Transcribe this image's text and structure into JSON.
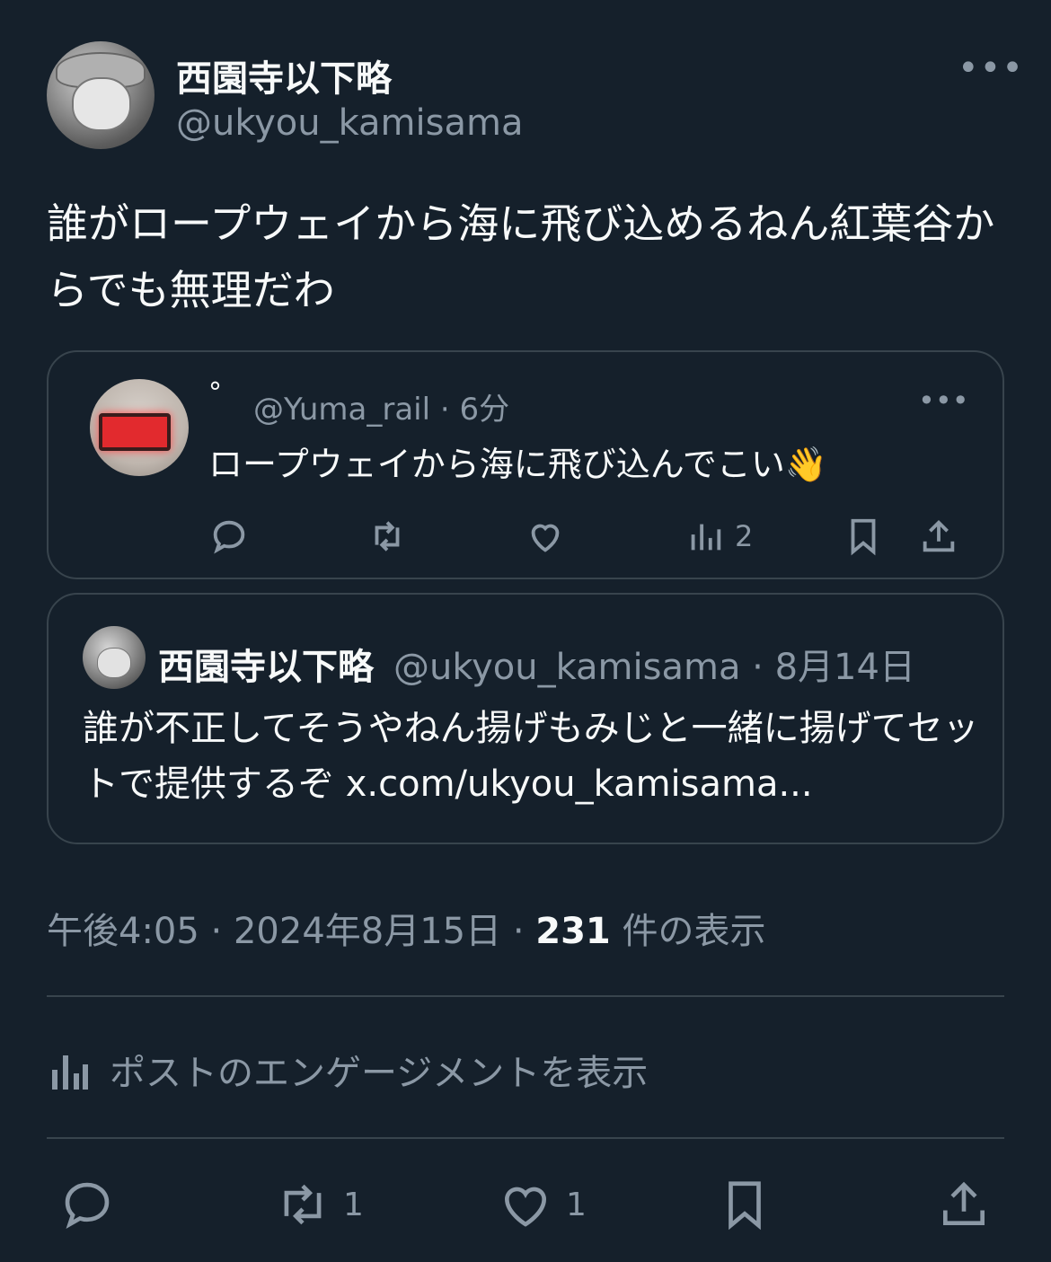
{
  "post": {
    "display_name": "西園寺以下略",
    "handle": "@ukyou_kamisama",
    "more": "•••",
    "text": "誰がロープウェイから海に飛び込めるねん紅葉谷からでも無理だわ"
  },
  "quote1": {
    "display_name": "°",
    "meta": "@Yuma_rail · 6分",
    "more": "•••",
    "text": "ロープウェイから海に飛び込んでこい👋",
    "actions": {
      "views_count": "2"
    }
  },
  "quote2": {
    "display_name": "西園寺以下略",
    "meta": "@ukyou_kamisama · 8月14日",
    "text": "誰が不正してそうやねん揚げもみじと一緒に揚げてセットで提供するぞ x.com/ukyou_kamisama..."
  },
  "timestamp": {
    "time_date": "午後4:05 · 2024年8月15日 · ",
    "views_count": "231",
    "views_label": " 件の表示"
  },
  "engagement": {
    "label": "ポストのエンゲージメントを表示"
  },
  "bottom_actions": {
    "retweet_count": "1",
    "like_count": "1"
  },
  "colors": {
    "background": "#15202b",
    "text": "#f7f9f9",
    "muted": "#8b98a5",
    "border": "#38444d"
  }
}
